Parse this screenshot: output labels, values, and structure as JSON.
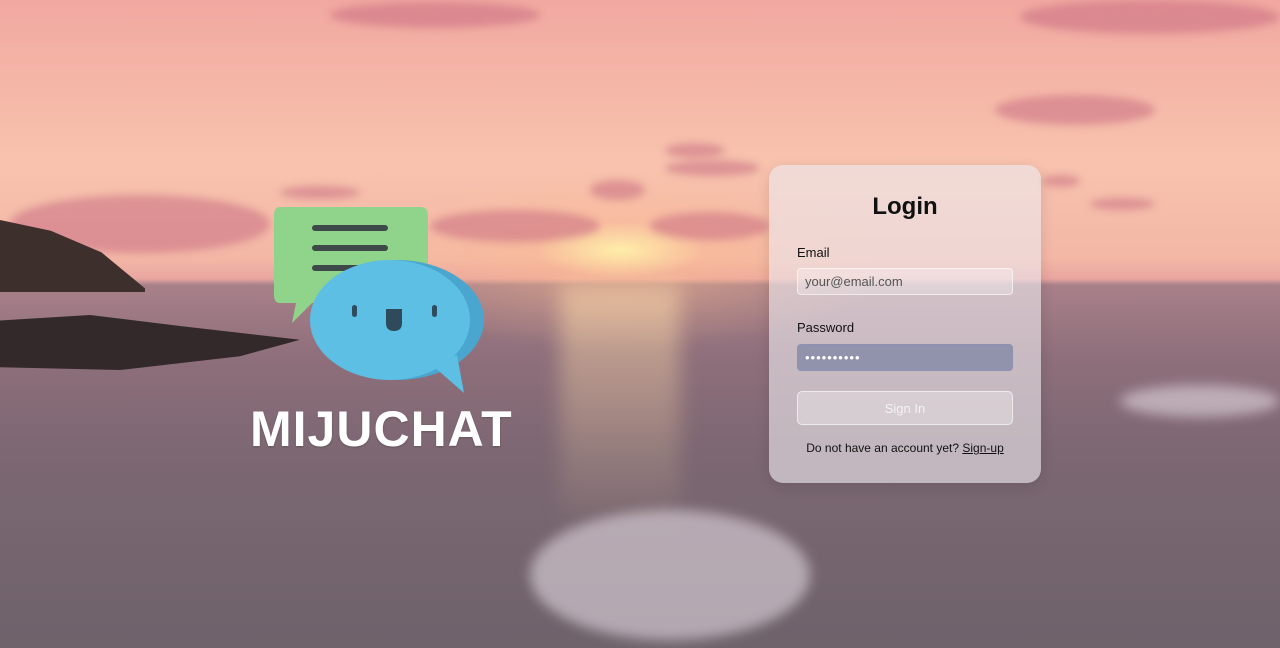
{
  "brand": {
    "name": "MIJUCHAT",
    "icon": "chat-bubbles-logo"
  },
  "login": {
    "title": "Login",
    "email_label": "Email",
    "email_placeholder": "your@email.com",
    "email_value": "",
    "password_label": "Password",
    "password_value": "••••••••••",
    "submit_label": "Sign In",
    "signup_prompt": "Do not have an account yet?",
    "signup_link": "Sign-up"
  },
  "colors": {
    "green_bubble": "#8fd48a",
    "blue_bubble": "#5dbfe3",
    "password_fill": "#8287a5"
  }
}
